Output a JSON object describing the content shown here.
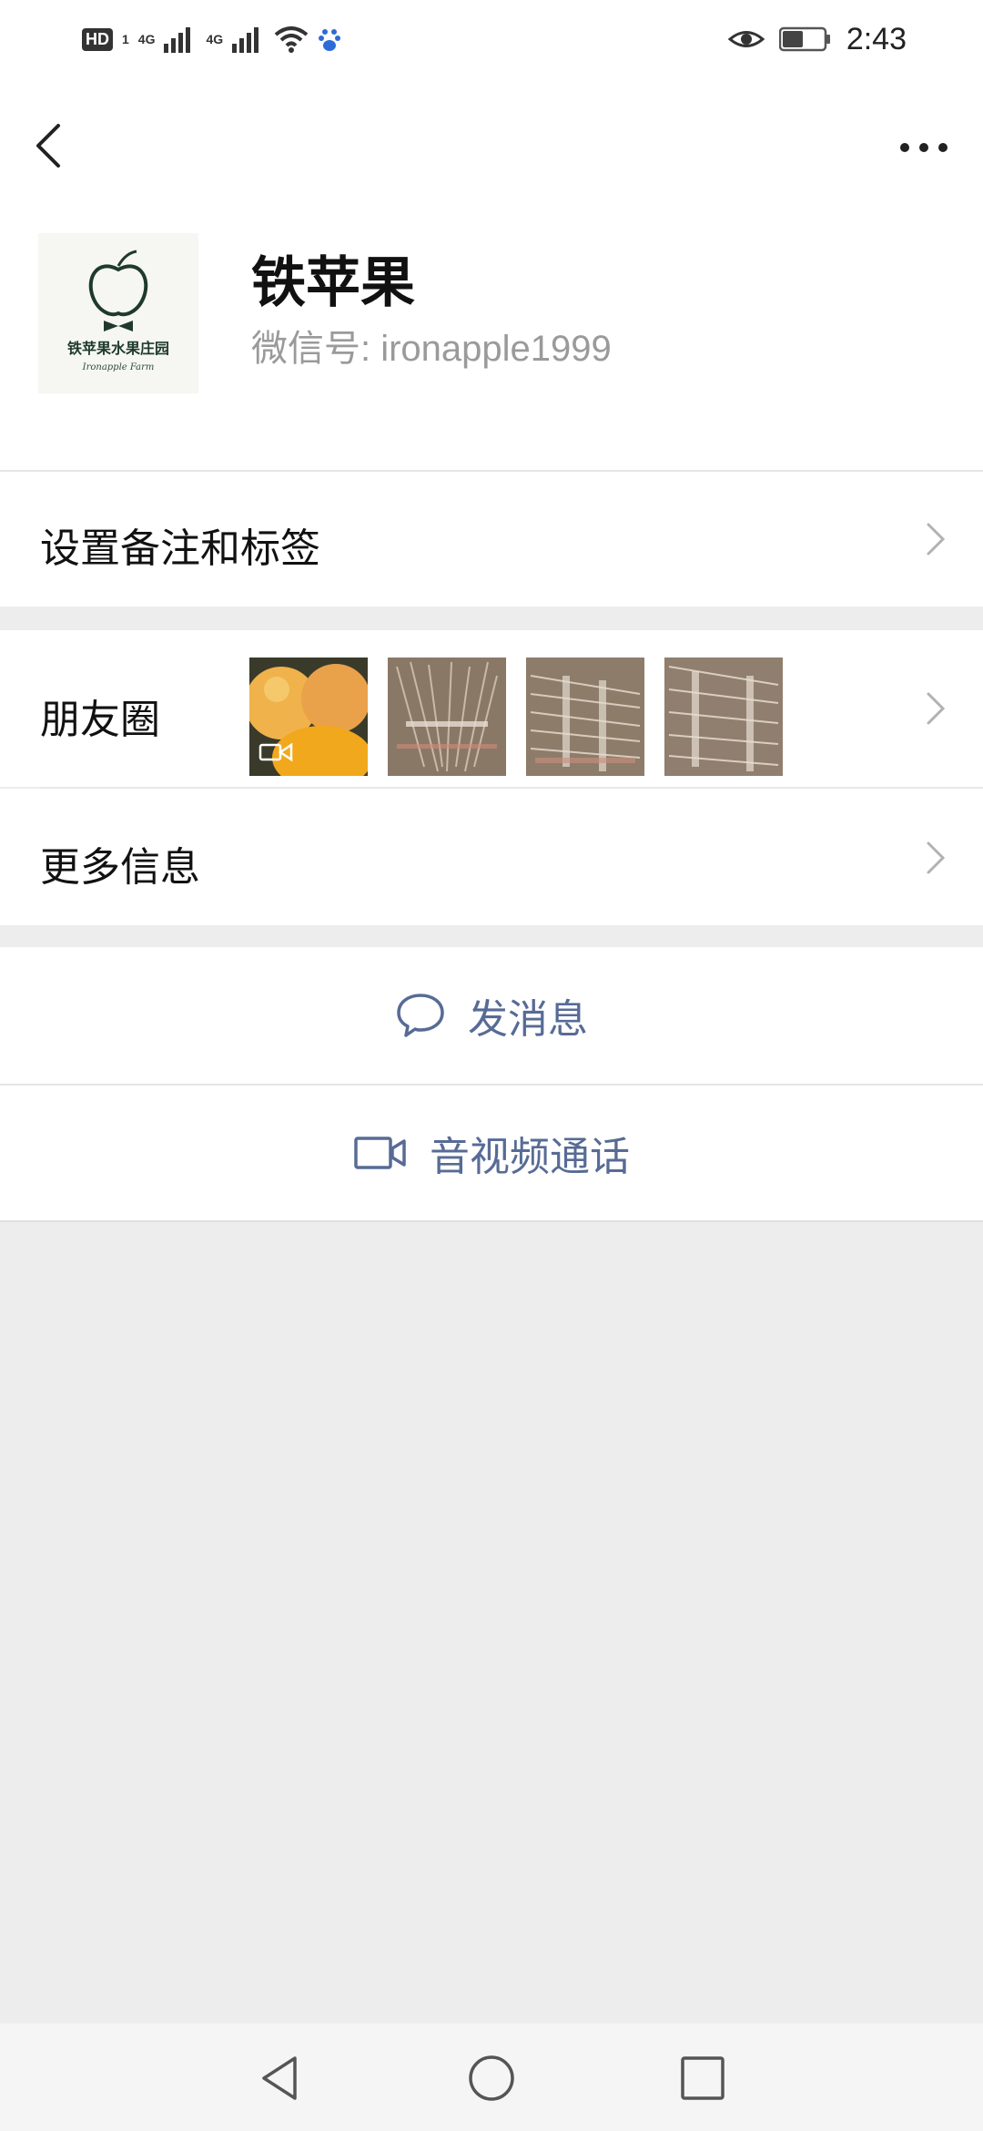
{
  "status_bar": {
    "left_badge": "HD",
    "left_badge_sub": "1",
    "network_1": "4G",
    "network_2": "4G",
    "time": "2:43"
  },
  "profile": {
    "name": "铁苹果",
    "wechat_id": "微信号: ironapple1999",
    "avatar_text_cn": "铁苹果水果庄园",
    "avatar_text_en": "Ironapple Farm"
  },
  "menu": {
    "remark_label": "设置备注和标签",
    "moments_label": "朋友圈",
    "more_info_label": "更多信息"
  },
  "actions": {
    "message_label": "发消息",
    "call_label": "音视频通话"
  },
  "colors": {
    "accent": "#576b95",
    "background": "#ededed"
  }
}
